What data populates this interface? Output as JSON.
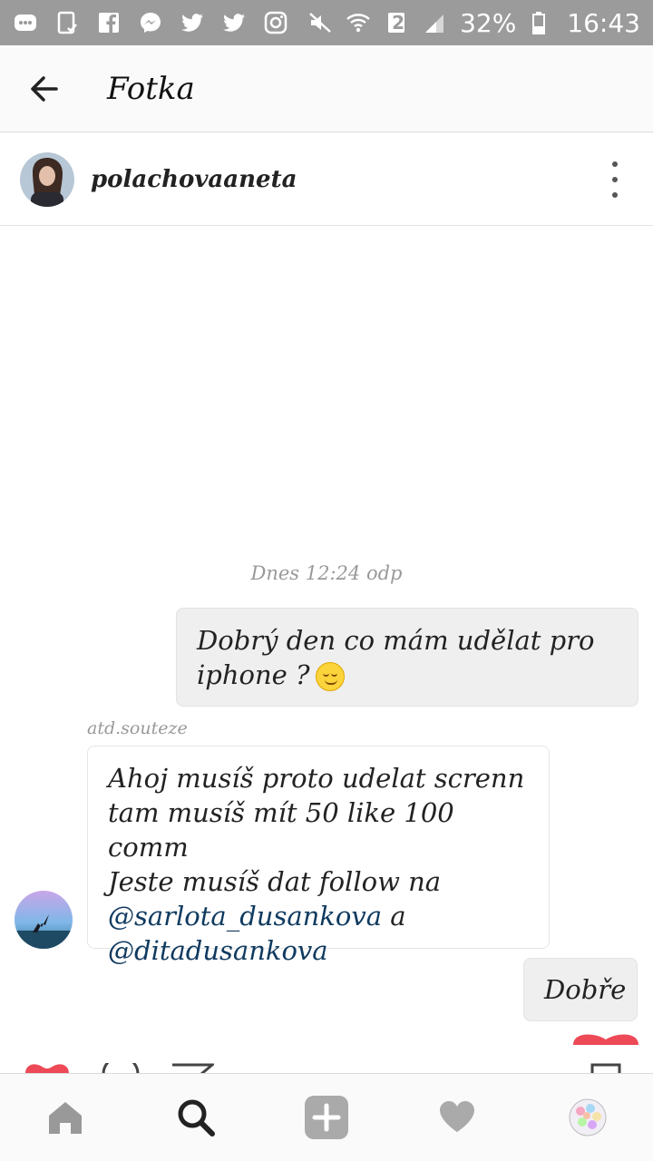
{
  "status_bar": {
    "battery": "32%",
    "time": "16:43",
    "sim": "2",
    "icons": [
      "chat-icon",
      "clipboard-check-icon",
      "facebook-icon",
      "messenger-icon",
      "twitter-icon",
      "twitter-icon",
      "instagram-icon",
      "mute-icon",
      "wifi-icon",
      "sim-2-icon",
      "signal-icon",
      "battery-icon"
    ]
  },
  "app_bar": {
    "title": "Fotka",
    "back_icon": "arrow-left-icon"
  },
  "conversation": {
    "username": "polachovaaneta",
    "more_icon": "more-vertical-icon"
  },
  "messages": {
    "timestamp": "Dnes 12:24 odp",
    "outgoing_1": "Dobrý den co mám udělat pro iphone ?",
    "sender_label": "atd.souteze",
    "incoming_lines": [
      "Ahoj musíš proto udelat screnn",
      "tam musíš mít 50 like 100 comm",
      "Jeste musíš dat follow na"
    ],
    "mention_1": "@sarlota_dusankova",
    "conjunction": "a",
    "mention_2": "@ditadusankova",
    "outgoing_2": "Dobře"
  },
  "bottom_nav": [
    "home-icon",
    "search-icon",
    "add-icon",
    "heart-icon",
    "profile-avatar"
  ],
  "colors": {
    "status_bar": "#9b9b9b",
    "mention": "#0f3a5f",
    "heart": "#ed4956"
  }
}
